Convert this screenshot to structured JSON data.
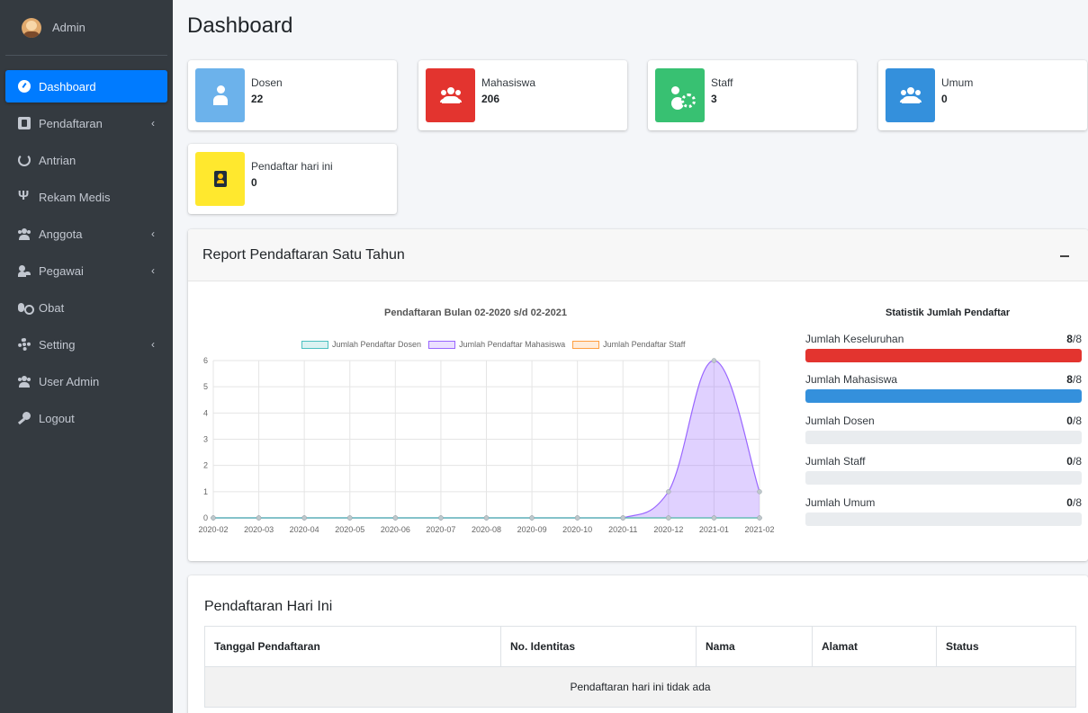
{
  "sidebar": {
    "user": "Admin",
    "items": [
      {
        "label": "Dashboard",
        "icon": "tachometer-icon"
      },
      {
        "label": "Pendaftaran",
        "icon": "address-book-icon"
      },
      {
        "label": "Antrian",
        "icon": "sync-icon"
      },
      {
        "label": "Rekam Medis",
        "icon": "stethoscope-icon"
      },
      {
        "label": "Anggota",
        "icon": "users-icon"
      },
      {
        "label": "Pegawai",
        "icon": "user-cog-icon"
      },
      {
        "label": "Obat",
        "icon": "pills-icon"
      },
      {
        "label": "Setting",
        "icon": "cog-icon"
      },
      {
        "label": "User Admin",
        "icon": "users-cog-icon"
      },
      {
        "label": "Logout",
        "icon": "key-icon"
      }
    ],
    "arrow": "‹"
  },
  "header": {
    "title": "Dashboard"
  },
  "info_boxes": [
    {
      "label": "Dosen",
      "value": "22",
      "color": "#6cb2eb"
    },
    {
      "label": "Mahasiswa",
      "value": "206",
      "color": "#e3342f"
    },
    {
      "label": "Staff",
      "value": "3",
      "color": "#38c172"
    },
    {
      "label": "Umum",
      "value": "0",
      "color": "#3490dc"
    },
    {
      "label": "Pendaftar hari ini",
      "value": "0",
      "color": "#ffe82e"
    }
  ],
  "report": {
    "title": "Report Pendaftaran Satu Tahun"
  },
  "chart_data": {
    "type": "area",
    "title": "Pendaftaran Bulan 02-2020 s/d 02-2021",
    "x": [
      "2020-02",
      "2020-03",
      "2020-04",
      "2020-05",
      "2020-06",
      "2020-07",
      "2020-08",
      "2020-09",
      "2020-10",
      "2020-11",
      "2020-12",
      "2021-01",
      "2021-02"
    ],
    "series": [
      {
        "name": "Jumlah Pendaftar Dosen",
        "values": [
          0,
          0,
          0,
          0,
          0,
          0,
          0,
          0,
          0,
          0,
          0,
          0,
          0
        ],
        "color": "#4bc0c0"
      },
      {
        "name": "Jumlah Pendaftar Mahasiswa",
        "values": [
          0,
          0,
          0,
          0,
          0,
          0,
          0,
          0,
          0,
          0,
          1,
          6,
          1
        ],
        "color": "#9966ff"
      },
      {
        "name": "Jumlah Pendaftar Staff",
        "values": [
          0,
          0,
          0,
          0,
          0,
          0,
          0,
          0,
          0,
          0,
          0,
          0,
          0
        ],
        "color": "#ff9f40"
      }
    ],
    "yticks": [
      "0",
      "1",
      "2",
      "3",
      "4",
      "5",
      "6"
    ],
    "ylim": [
      0,
      6
    ],
    "grid": true,
    "legend": "top"
  },
  "stats": {
    "title": "Statistik Jumlah Pendaftar",
    "items": [
      {
        "label": "Jumlah Keseluruhan",
        "count": "8",
        "total": "/8",
        "fraction": 1,
        "color": "#e3342f"
      },
      {
        "label": "Jumlah Mahasiswa",
        "count": "8",
        "total": "/8",
        "fraction": 1,
        "color": "#3490dc"
      },
      {
        "label": "Jumlah Dosen",
        "count": "0",
        "total": "/8",
        "fraction": 0,
        "color": "#38c172"
      },
      {
        "label": "Jumlah Staff",
        "count": "0",
        "total": "/8",
        "fraction": 0,
        "color": "#38c172"
      },
      {
        "label": "Jumlah Umum",
        "count": "0",
        "total": "/8",
        "fraction": 0,
        "color": "#38c172"
      }
    ]
  },
  "today": {
    "title": "Pendaftaran Hari Ini",
    "columns": [
      "Tanggal Pendaftaran",
      "No. Identitas",
      "Nama",
      "Alamat",
      "Status"
    ],
    "empty": "Pendaftaran hari ini tidak ada"
  }
}
